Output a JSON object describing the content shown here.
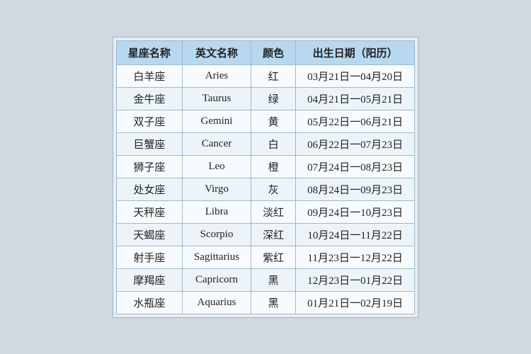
{
  "table": {
    "headers": [
      "星座名称",
      "英文名称",
      "颜色",
      "出生日期（阳历）"
    ],
    "rows": [
      {
        "chinese": "白羊座",
        "english": "Aries",
        "color": "红",
        "dates": "03月21日一04月20日"
      },
      {
        "chinese": "金牛座",
        "english": "Taurus",
        "color": "绿",
        "dates": "04月21日一05月21日"
      },
      {
        "chinese": "双子座",
        "english": "Gemini",
        "color": "黄",
        "dates": "05月22日一06月21日"
      },
      {
        "chinese": "巨蟹座",
        "english": "Cancer",
        "color": "白",
        "dates": "06月22日一07月23日"
      },
      {
        "chinese": "狮子座",
        "english": "Leo",
        "color": "橙",
        "dates": "07月24日一08月23日"
      },
      {
        "chinese": "处女座",
        "english": "Virgo",
        "color": "灰",
        "dates": "08月24日一09月23日"
      },
      {
        "chinese": "天秤座",
        "english": "Libra",
        "color": "淡红",
        "dates": "09月24日一10月23日"
      },
      {
        "chinese": "天蝎座",
        "english": "Scorpio",
        "color": "深红",
        "dates": "10月24日一11月22日"
      },
      {
        "chinese": "射手座",
        "english": "Sagittarius",
        "color": "紫红",
        "dates": "11月23日一12月22日"
      },
      {
        "chinese": "摩羯座",
        "english": "Capricorn",
        "color": "黑",
        "dates": "12月23日一01月22日"
      },
      {
        "chinese": "水瓶座",
        "english": "Aquarius",
        "color": "黑",
        "dates": "01月21日一02月19日"
      }
    ]
  }
}
